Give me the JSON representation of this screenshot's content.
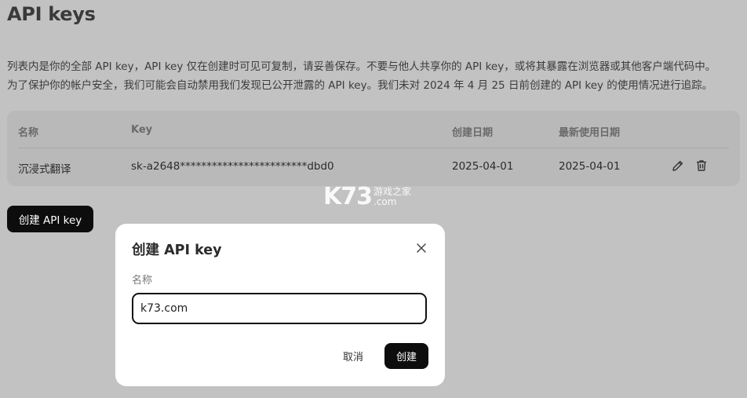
{
  "page": {
    "title": "API keys",
    "description_line1": "列表内是你的全部 API key，API key 仅在创建时可见可复制，请妥善保存。不要与他人共享你的 API key，或将其暴露在浏览器或其他客户端代码中。",
    "description_line2": "为了保护你的帐户安全，我们可能会自动禁用我们发现已公开泄露的 API key。我们未对 2024 年 4 月 25 日前创建的 API key 的使用情况进行追踪。"
  },
  "table": {
    "headers": {
      "name": "名称",
      "key": "Key",
      "created": "创建日期",
      "last_used": "最新使用日期"
    },
    "rows": [
      {
        "name": "沉浸式翻译",
        "key": "sk-a2648************************dbd0",
        "created": "2025-04-01",
        "last_used": "2025-04-01",
        "actions": [
          "pencil-icon",
          "trash-icon"
        ]
      }
    ]
  },
  "create_button_label": "创建 API key",
  "watermark": {
    "logo": "K73",
    "line1": "游戏之家",
    "line2": ".com"
  },
  "modal": {
    "title": "创建 API key",
    "field_label": "名称",
    "input_value": "k73.com",
    "cancel_label": "取消",
    "confirm_label": "创建",
    "close_icon": "close-icon"
  },
  "colors": {
    "overlay_bg": "#c2c2c2",
    "primary_button": "#0d0d0d",
    "modal_bg": "#ffffff"
  }
}
